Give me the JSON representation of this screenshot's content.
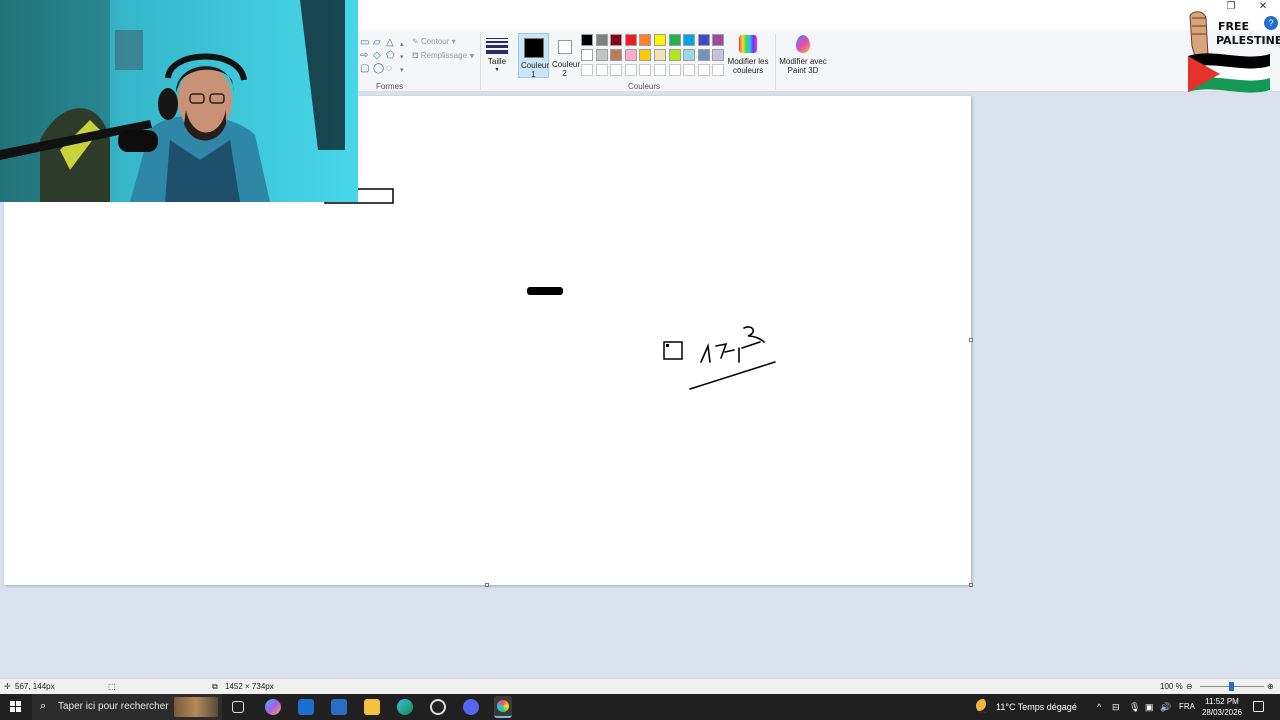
{
  "window": {
    "restore_glyph": "❐",
    "close_glyph": "✕",
    "help_glyph": "?"
  },
  "ribbon": {
    "shapes": {
      "group_label": "Formes",
      "contour_label": "Contour",
      "fill_label": "Remplissage",
      "dropdown_glyph": "▾"
    },
    "size": {
      "label": "Taille"
    },
    "colors": {
      "group_label": "Couleurs",
      "color1_label": "Couleur 1",
      "color2_label": "Couleur 2",
      "edit_colors_label": "Modifier les couleurs",
      "paint3d_label": "Modifier avec Paint 3D",
      "palette_row1": [
        "#000000",
        "#7f7f7f",
        "#880015",
        "#ed1c24",
        "#ff7f27",
        "#fff200",
        "#22b14c",
        "#00a2e8",
        "#3f48cc",
        "#a349a4"
      ],
      "palette_row2": [
        "#ffffff",
        "#c3c3c3",
        "#b97a57",
        "#ffaec9",
        "#ffc90e",
        "#efe4b0",
        "#b5e61d",
        "#99d9ea",
        "#7092be",
        "#c8bfe7"
      ],
      "custom_slots": 10
    }
  },
  "statusbar": {
    "cursor_position": "567, 144px",
    "canvas_size": "1452 × 734px",
    "zoom_level": "100 %"
  },
  "taskbar": {
    "search_placeholder": "Taper ici pour rechercher",
    "weather": "11°C  Temps dégagé",
    "language": "FRA",
    "time": "11:52 PM",
    "date": "28/03/2026"
  },
  "badge": {
    "line1": "FREE",
    "line2": "PALESTINE",
    "flag_colors": [
      "#000000",
      "#ffffff",
      "#149954",
      "#e4312b"
    ]
  }
}
